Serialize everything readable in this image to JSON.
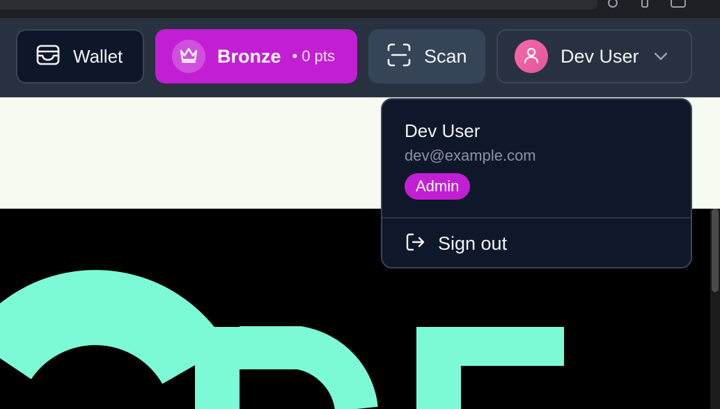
{
  "header": {
    "wallet_label": "Wallet",
    "tier_label": "Bronze",
    "points_label": "• 0 pts",
    "scan_label": "Scan",
    "user_name": "Dev User"
  },
  "user_menu": {
    "name": "Dev User",
    "email": "dev@example.com",
    "role_badge": "Admin",
    "sign_out_label": "Sign out"
  },
  "icons": [
    "wallet-icon",
    "crown-icon",
    "scan-icon",
    "user-icon",
    "chevron-down-icon",
    "sign-out-icon"
  ],
  "colors": {
    "accent": "#c21fd4",
    "navbar": "#283140",
    "menu_bg": "#0f172a",
    "avatar": "#f76aa8",
    "hero_text": "#7cfad5"
  }
}
